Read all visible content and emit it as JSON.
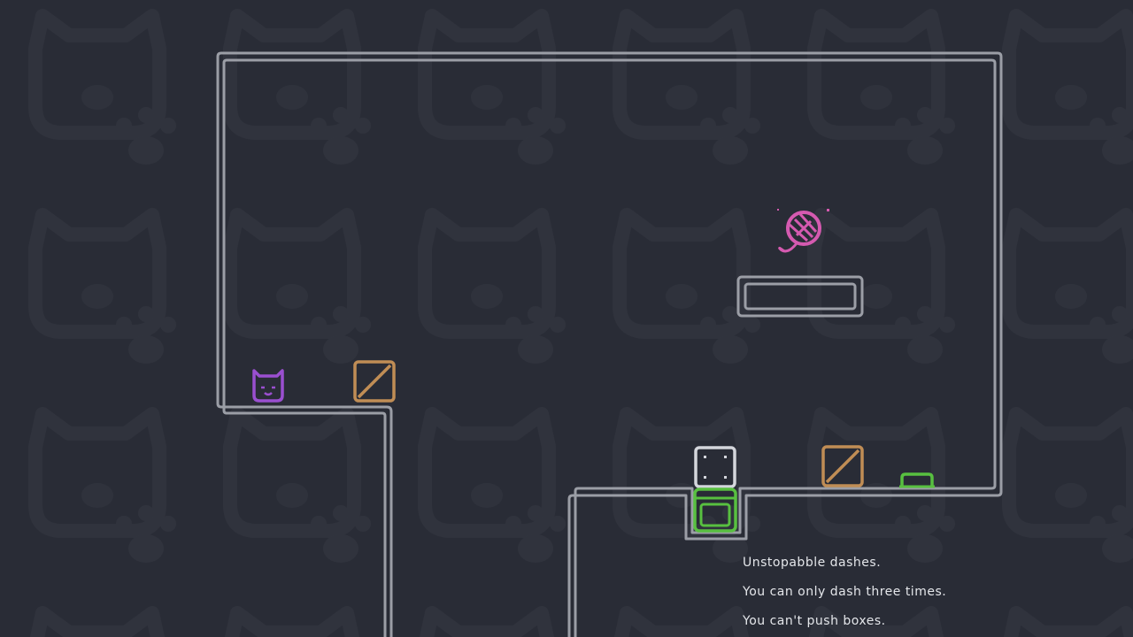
{
  "level": {
    "hints": [
      "Unstopabble dashes.",
      "You can only dash three times.",
      "You can't push boxes."
    ]
  },
  "entities": {
    "player": "cat-icon",
    "goal": "yarn-ball-icon",
    "pushable_boxes": 2,
    "locked_block": "dotted-block-icon",
    "switch_block": "green-block-icon",
    "pressure_button": "green-button-icon"
  },
  "colors": {
    "background": "#292c36",
    "background_pattern": "#30333d",
    "wall": "#9b9ea6",
    "player": "#9a4fd0",
    "goal": "#d55ab0",
    "box": "#c08d55",
    "switch": "#58c040",
    "locked_block": "#d4d6dc",
    "text": "#e4e6ea"
  }
}
